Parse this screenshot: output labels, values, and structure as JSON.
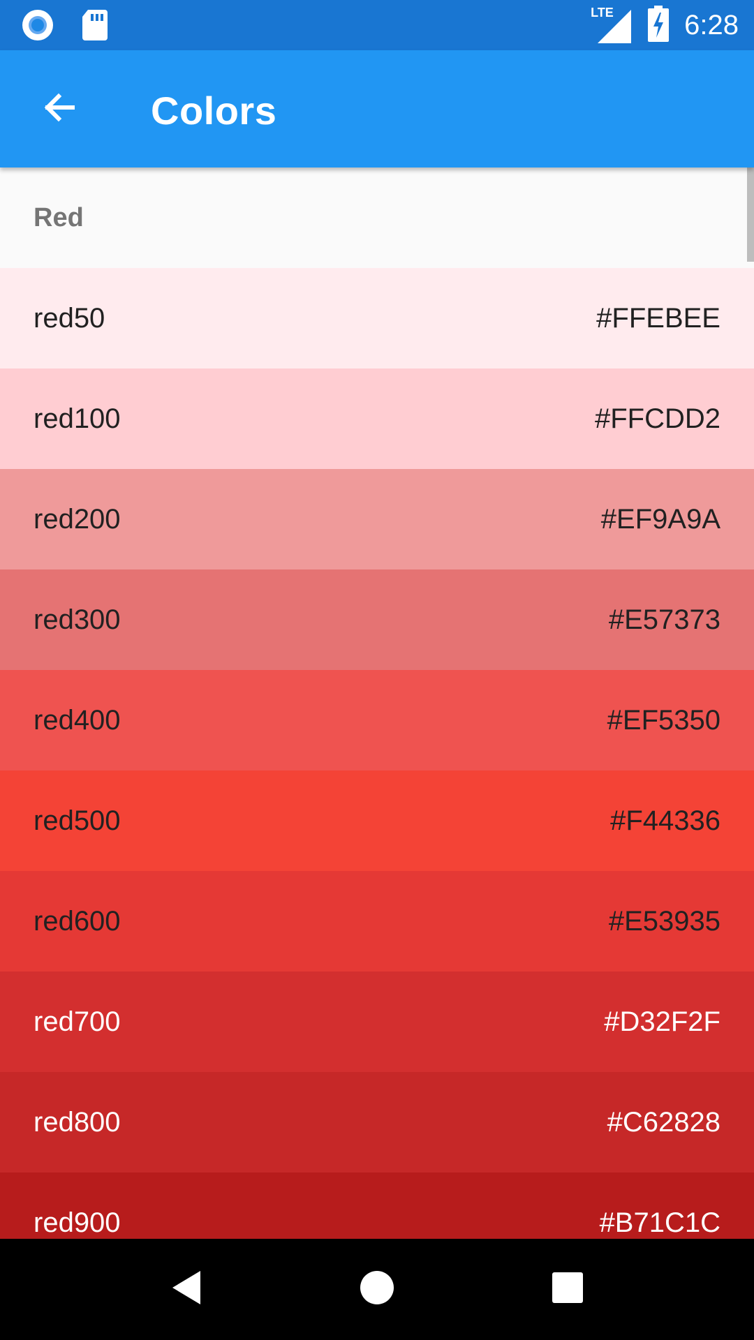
{
  "status_bar": {
    "time": "6:28",
    "network": "LTE",
    "icons": [
      "circle-notification-icon",
      "sd-card-icon",
      "lte-signal-icon",
      "battery-charging-icon"
    ]
  },
  "app_bar": {
    "title": "Colors",
    "back_icon": "arrow-back-icon",
    "background": "#2196F3"
  },
  "section": {
    "title": "Red"
  },
  "colors": [
    {
      "name": "red50",
      "hex": "#FFEBEE",
      "text_color": "#212121"
    },
    {
      "name": "red100",
      "hex": "#FFCDD2",
      "text_color": "#212121"
    },
    {
      "name": "red200",
      "hex": "#EF9A9A",
      "text_color": "#212121"
    },
    {
      "name": "red300",
      "hex": "#E57373",
      "text_color": "#212121"
    },
    {
      "name": "red400",
      "hex": "#EF5350",
      "text_color": "#212121"
    },
    {
      "name": "red500",
      "hex": "#F44336",
      "text_color": "#212121"
    },
    {
      "name": "red600",
      "hex": "#E53935",
      "text_color": "#212121"
    },
    {
      "name": "red700",
      "hex": "#D32F2F",
      "text_color": "#FFFFFF"
    },
    {
      "name": "red800",
      "hex": "#C62828",
      "text_color": "#FFFFFF"
    },
    {
      "name": "red900",
      "hex": "#B71C1C",
      "text_color": "#FFFFFF"
    }
  ],
  "nav_bar": {
    "icons": [
      "back-triangle-icon",
      "home-circle-icon",
      "recents-square-icon"
    ]
  }
}
